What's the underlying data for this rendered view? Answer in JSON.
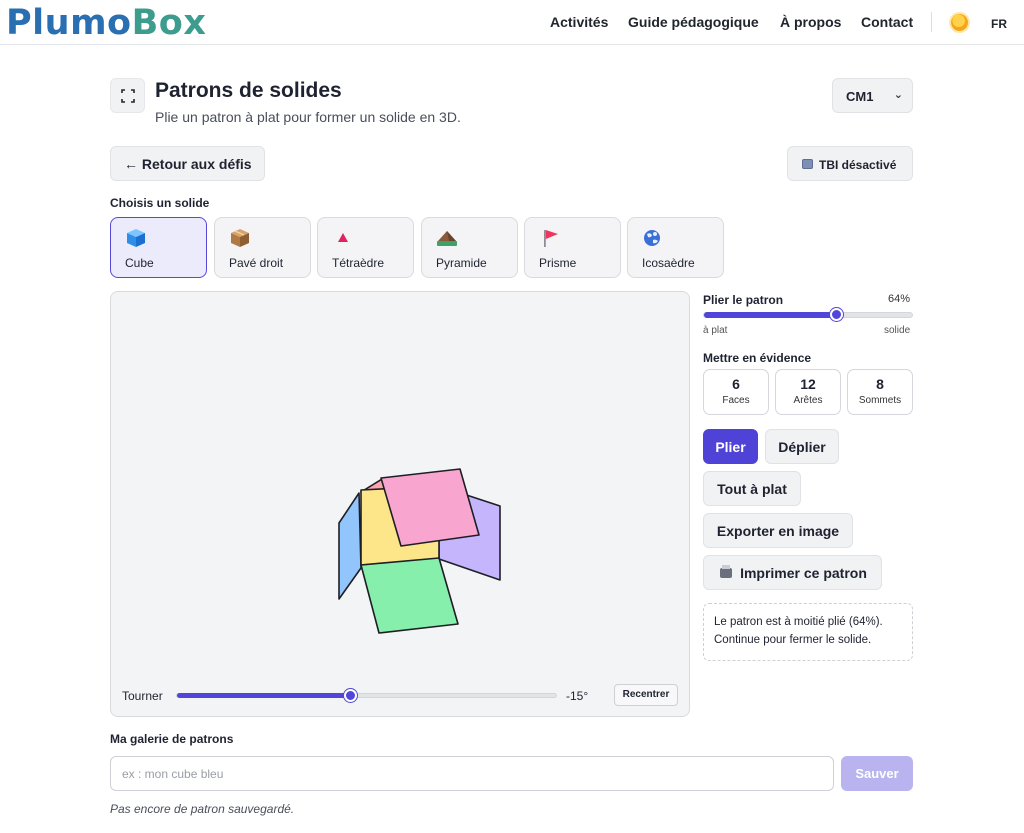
{
  "brand": {
    "logo_part1": "Plumo",
    "logo_part2": "Box",
    "color1": "#2b6fb3",
    "color2": "#3d9c8e"
  },
  "nav": {
    "items": [
      "Activités",
      "Guide pédagogique",
      "À propos",
      "Contact"
    ],
    "theme_icon": "sun-icon",
    "language": "FR"
  },
  "page": {
    "title": "Patrons de solides",
    "subtitle": "Plie un patron à plat pour former un solide en 3D.",
    "level": "CM1",
    "back_label": "← Retour aux défis",
    "tbi_label": "TBI désactivé"
  },
  "solid_picker": {
    "label": "Choisis un solide",
    "selected": "Cube",
    "solids": [
      {
        "label": "Cube",
        "icon": "cube-icon"
      },
      {
        "label": "Pavé droit",
        "icon": "box-icon"
      },
      {
        "label": "Tétraèdre",
        "icon": "triangle-icon"
      },
      {
        "label": "Pyramide",
        "icon": "pyramid-icon"
      },
      {
        "label": "Prisme",
        "icon": "flag-icon"
      },
      {
        "label": "Icosaèdre",
        "icon": "globe-icon"
      }
    ]
  },
  "viewer": {
    "face_colors": [
      "#fde58a",
      "#f8a6d0",
      "#86efac",
      "#93c5fd",
      "#c4b5fd",
      "#fda4af"
    ],
    "rotate_label": "Tourner",
    "rotate_value_text": "-15°",
    "rotate_fraction": 0.46,
    "recenter_label": "Recentrer"
  },
  "controls": {
    "fold_label": "Plier le patron",
    "fold_percent_text": "64%",
    "fold_fraction": 0.64,
    "fold_min_label": "à plat",
    "fold_max_label": "solide",
    "highlight_label": "Mettre en évidence",
    "counts": [
      {
        "value": "6",
        "label": "Faces"
      },
      {
        "value": "12",
        "label": "Arêtes"
      },
      {
        "value": "8",
        "label": "Sommets"
      }
    ],
    "fold_button": "Plier",
    "unfold_button": "Déplier",
    "flatten_button": "Tout à plat",
    "export_button": "Exporter en image",
    "print_button": "Imprimer ce patron",
    "status_line1": "Le patron est à moitié plié (64%).",
    "status_line2": "Continue pour fermer le solide.",
    "accent_color": "#4f42d6"
  },
  "gallery": {
    "label": "Ma galerie de patrons",
    "name_placeholder": "ex : mon cube bleu",
    "name_value": "",
    "save_label": "Sauver",
    "empty_text": "Pas encore de patron sauvegardé."
  }
}
